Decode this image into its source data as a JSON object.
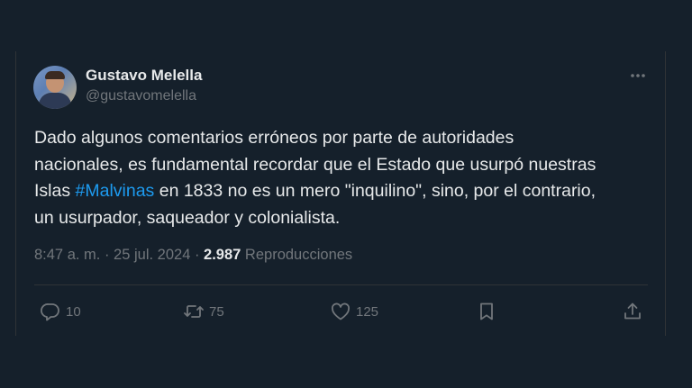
{
  "author": {
    "name": "Gustavo Melella",
    "handle": "@gustavomelella"
  },
  "tweet": {
    "line1": "Dado algunos comentarios erróneos por parte de autoridades",
    "line2": "nacionales, es fundamental recordar que el Estado que usurpó nuestras",
    "line3_prefix": "Islas ",
    "hashtag": "#Malvinas",
    "line3_suffix": " en 1833 no es un mero \"inquilino\", sino, por el contrario,",
    "line4": "un usurpador, saqueador y colonialista."
  },
  "meta": {
    "time": "8:47 a. m.",
    "separator": " · ",
    "date": "25 jul. 2024",
    "views_count": "2.987",
    "views_label": " Reproducciones"
  },
  "actions": {
    "replies": "10",
    "retweets": "75",
    "likes": "125"
  },
  "icons": {
    "reply": "reply-icon",
    "retweet": "retweet-icon",
    "like": "heart-icon",
    "bookmark": "bookmark-icon",
    "share": "share-icon",
    "more": "more-icon"
  },
  "colors": {
    "background": "#15202b",
    "text": "#e7e9ea",
    "muted": "#71767b",
    "link": "#1d9bf0",
    "border": "#2f3336"
  }
}
